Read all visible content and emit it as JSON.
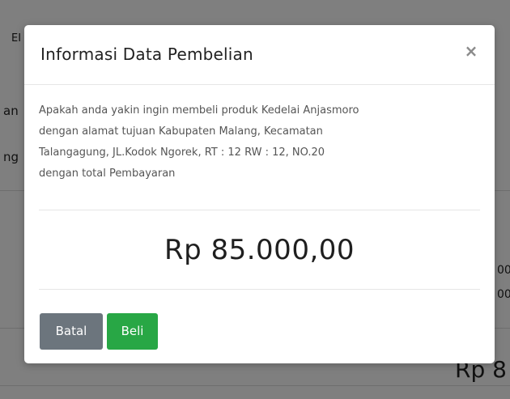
{
  "background": {
    "top_left": "EI",
    "left_1": "an",
    "left_2": "ng",
    "right_1": "00",
    "right_2": "00",
    "right_total": "Rp 8"
  },
  "modal": {
    "title": "Informasi Data Pembelian",
    "close_symbol": "×",
    "message_line_1": "Apakah anda yakin ingin membeli produk Kedelai Anjasmoro",
    "message_line_2": "dengan alamat tujuan Kabupaten Malang, Kecamatan",
    "message_line_3": "Talangagung, JL.Kodok Ngorek, RT : 12 RW : 12, NO.20",
    "message_line_4": "dengan total Pembayaran",
    "total": "Rp 85.000,00",
    "buttons": {
      "cancel": "Batal",
      "buy": "Beli"
    }
  },
  "colors": {
    "backdrop": "rgba(0,0,0,0.5)",
    "cancel_button": "#6c757d",
    "buy_button": "#28a745"
  }
}
